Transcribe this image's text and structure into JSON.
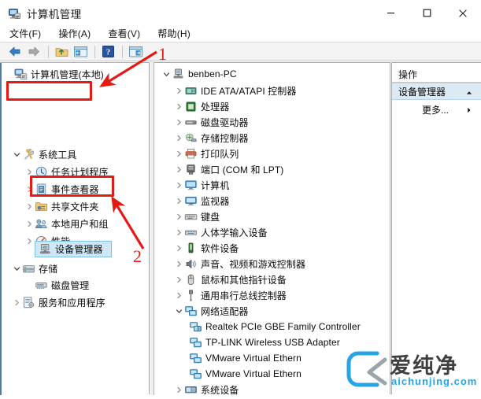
{
  "window": {
    "title": "计算机管理",
    "icon": "computer-management-icon",
    "buttons": {
      "minimize": "—",
      "maximize": "□",
      "close": "✕"
    }
  },
  "menubar": {
    "items": [
      {
        "label": "文件(F)",
        "name": "menu-file"
      },
      {
        "label": "操作(A)",
        "name": "menu-action"
      },
      {
        "label": "查看(V)",
        "name": "menu-view"
      },
      {
        "label": "帮助(H)",
        "name": "menu-help"
      }
    ]
  },
  "toolbar": {
    "buttons": [
      {
        "name": "back-arrow-icon",
        "title": "后退"
      },
      {
        "name": "forward-arrow-icon",
        "title": "前进"
      },
      {
        "name": "up-folder-icon",
        "title": "上移一级"
      },
      {
        "name": "show-hide-console-tree-icon",
        "title": "显示/隐藏控制台树"
      },
      {
        "name": "help-icon",
        "title": "帮助"
      },
      {
        "name": "show-hide-action-pane-icon",
        "title": "显示/隐藏操作窗格"
      }
    ]
  },
  "tree_pane": {
    "root": {
      "label": "计算机管理(本地)",
      "icon": "computer-management-icon",
      "indent": 4,
      "chevron": "none"
    },
    "items": [
      {
        "label": "系统工具",
        "icon": "system-tools-icon",
        "indent": 14,
        "chevron": "down",
        "selected": false,
        "highlight_box": 1
      },
      {
        "label": "任务计划程序",
        "icon": "task-scheduler-icon",
        "indent": 30,
        "chevron": "right",
        "selected": false
      },
      {
        "label": "事件查看器",
        "icon": "event-viewer-icon",
        "indent": 30,
        "chevron": "right",
        "selected": false
      },
      {
        "label": "共享文件夹",
        "icon": "shared-folders-icon",
        "indent": 30,
        "chevron": "right",
        "selected": false
      },
      {
        "label": "本地用户和组",
        "icon": "local-users-icon",
        "indent": 30,
        "chevron": "right",
        "selected": false
      },
      {
        "label": "性能",
        "icon": "performance-icon",
        "indent": 30,
        "chevron": "right",
        "selected": false
      },
      {
        "label": "设备管理器",
        "icon": "device-manager-icon",
        "indent": 44,
        "chevron": "none",
        "selected": true,
        "highlight_box": 2
      },
      {
        "label": "存储",
        "icon": "storage-icon",
        "indent": 14,
        "chevron": "down",
        "selected": false
      },
      {
        "label": "磁盘管理",
        "icon": "disk-management-icon",
        "indent": 44,
        "chevron": "none",
        "selected": false
      },
      {
        "label": "服务和应用程序",
        "icon": "services-apps-icon",
        "indent": 14,
        "chevron": "right",
        "selected": false
      }
    ]
  },
  "device_pane": {
    "root": {
      "label": "benben-PC",
      "icon": "pc-icon",
      "indent": 8,
      "chevron": "down"
    },
    "items": [
      {
        "label": "IDE ATA/ATAPI 控制器",
        "icon": "ide-controller-icon",
        "indent": 28,
        "chevron": "right"
      },
      {
        "label": "处理器",
        "icon": "processor-icon",
        "indent": 28,
        "chevron": "right"
      },
      {
        "label": "磁盘驱动器",
        "icon": "disk-drive-icon",
        "indent": 28,
        "chevron": "right"
      },
      {
        "label": "存储控制器",
        "icon": "storage-controller-icon",
        "indent": 28,
        "chevron": "right"
      },
      {
        "label": "打印队列",
        "icon": "print-queue-icon",
        "indent": 28,
        "chevron": "right"
      },
      {
        "label": "端口 (COM 和 LPT)",
        "icon": "ports-icon",
        "indent": 28,
        "chevron": "right"
      },
      {
        "label": "计算机",
        "icon": "computer-icon",
        "indent": 28,
        "chevron": "right"
      },
      {
        "label": "监视器",
        "icon": "monitor-icon",
        "indent": 28,
        "chevron": "right"
      },
      {
        "label": "键盘",
        "icon": "keyboard-icon",
        "indent": 28,
        "chevron": "right"
      },
      {
        "label": "人体学输入设备",
        "icon": "hid-icon",
        "indent": 28,
        "chevron": "right"
      },
      {
        "label": "软件设备",
        "icon": "software-device-icon",
        "indent": 28,
        "chevron": "right"
      },
      {
        "label": "声音、视频和游戏控制器",
        "icon": "sound-video-icon",
        "indent": 28,
        "chevron": "right"
      },
      {
        "label": "鼠标和其他指针设备",
        "icon": "mouse-icon",
        "indent": 28,
        "chevron": "right"
      },
      {
        "label": "通用串行总线控制器",
        "icon": "usb-controller-icon",
        "indent": 28,
        "chevron": "right"
      },
      {
        "label": "网络适配器",
        "icon": "network-adapter-icon",
        "indent": 28,
        "chevron": "down"
      },
      {
        "label": "Realtek PCIe GBE Family Controller",
        "icon": "network-adapter-icon",
        "indent": 48,
        "chevron": "none"
      },
      {
        "label": "TP-LINK Wireless USB Adapter",
        "icon": "network-adapter-icon",
        "indent": 48,
        "chevron": "none"
      },
      {
        "label": "VMware Virtual Ethern",
        "icon": "network-adapter-icon",
        "indent": 48,
        "chevron": "none"
      },
      {
        "label": "VMware Virtual Ethern",
        "icon": "network-adapter-icon",
        "indent": 48,
        "chevron": "none"
      },
      {
        "label": "系统设备",
        "icon": "system-device-icon",
        "indent": 28,
        "chevron": "right"
      }
    ]
  },
  "actions_pane": {
    "title": "操作",
    "group_label": "设备管理器",
    "group_caret": "▲",
    "more_label": "更多...",
    "more_caret": "▶"
  },
  "annotations": {
    "marker_one": "1",
    "marker_two": "2",
    "color": "#e31b14"
  },
  "watermark": {
    "text": "爱纯净",
    "sub": "aichunjing.com",
    "accent": "#29a3e3"
  }
}
